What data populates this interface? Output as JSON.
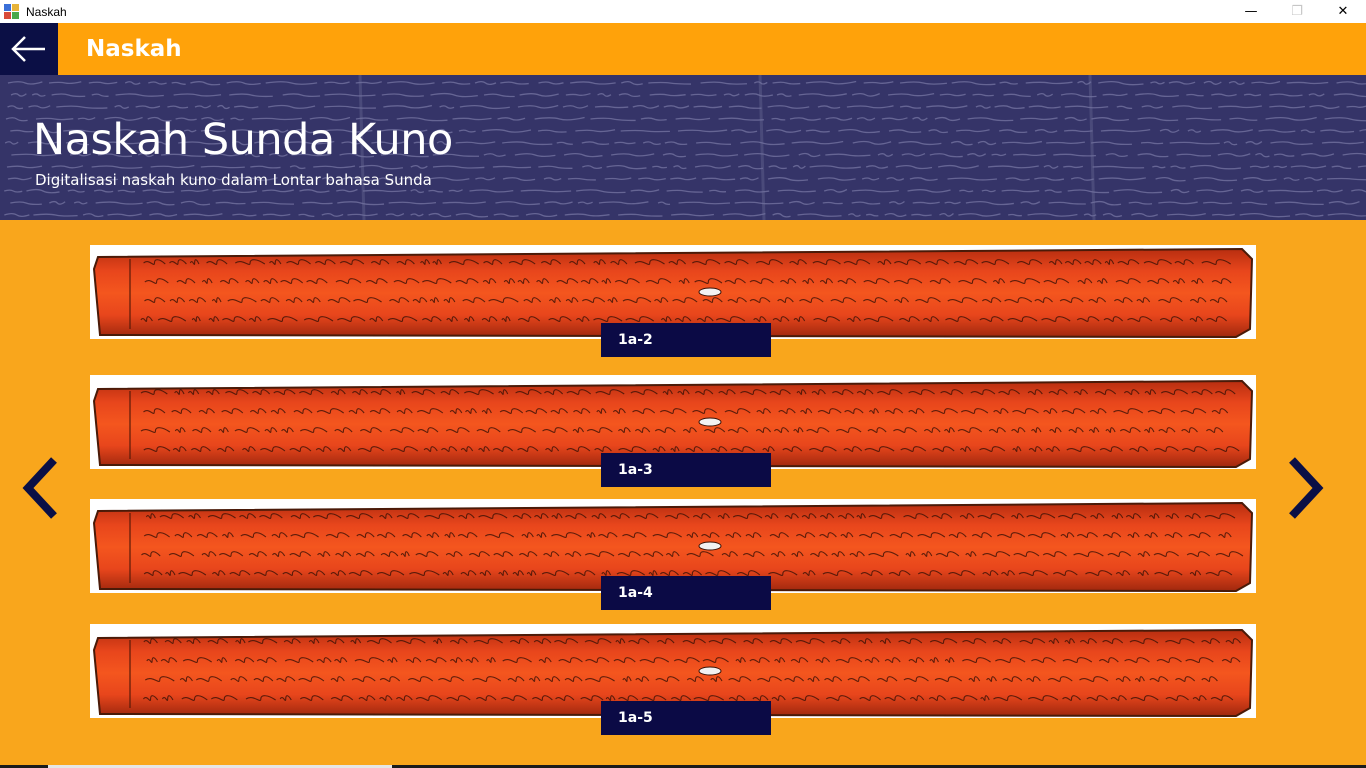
{
  "window": {
    "title": "Naskah",
    "minimize_glyph": "—",
    "restore_glyph": "❐",
    "close_glyph": "✕"
  },
  "header": {
    "title": "Naskah",
    "back_icon": "arrow-left-icon"
  },
  "banner": {
    "title": "Naskah Sunda Kuno",
    "subtitle": "Digitalisasi naskah kuno dalam Lontar bahasa Sunda"
  },
  "manuscripts": [
    {
      "label": "1a-2"
    },
    {
      "label": "1a-3"
    },
    {
      "label": "1a-4"
    },
    {
      "label": "1a-5"
    }
  ],
  "navigation": {
    "prev_icon": "chevron-left-icon",
    "next_icon": "chevron-right-icon"
  },
  "colors": {
    "page_background": "#f9a61c",
    "header_background": "#ffa20a",
    "accent_dark": "#0b0f45",
    "banner_background": "#353468",
    "leaf_color": "#e8461c"
  }
}
